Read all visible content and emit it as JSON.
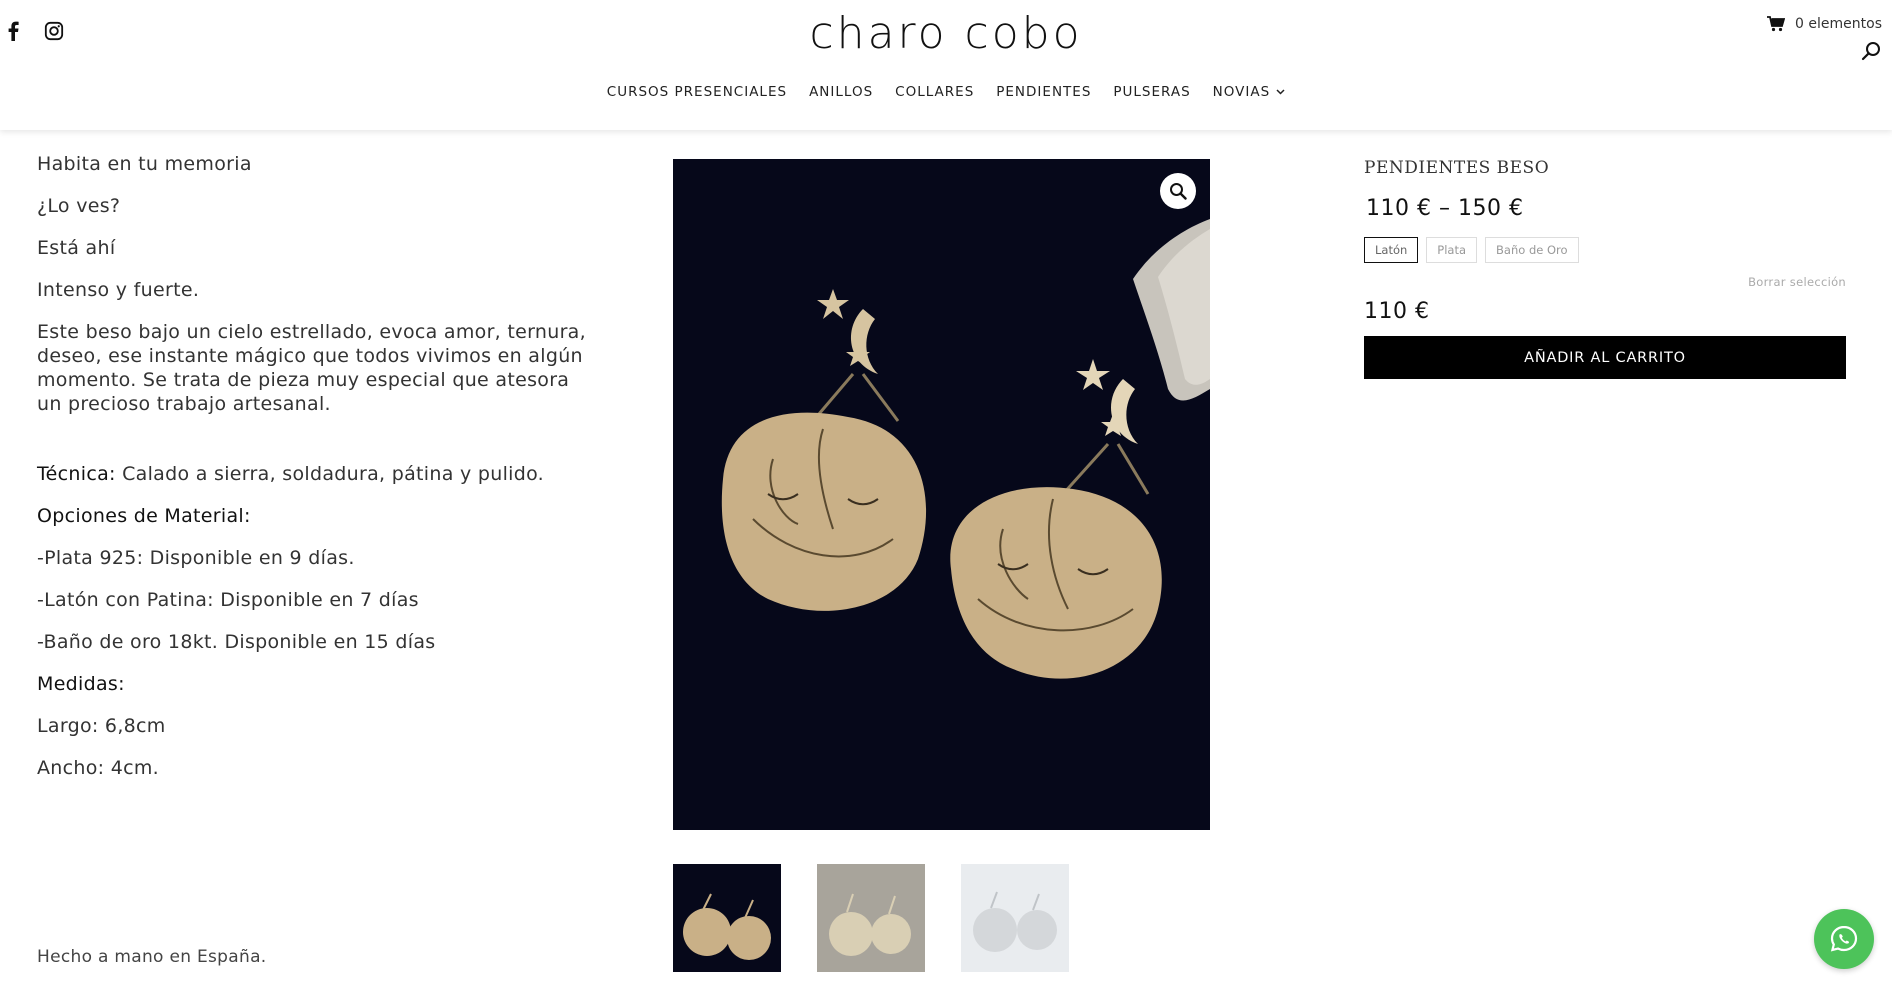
{
  "header": {
    "logo": "charo cobo",
    "cart_text": "0 elementos",
    "social": {
      "facebook_icon": "facebook-icon",
      "instagram_icon": "instagram-icon"
    },
    "nav": [
      {
        "label": "CURSOS PRESENCIALES"
      },
      {
        "label": "ANILLOS"
      },
      {
        "label": "COLLARES"
      },
      {
        "label": "PENDIENTES"
      },
      {
        "label": "PULSERAS"
      },
      {
        "label": "NOVIAS",
        "has_dropdown": true
      }
    ]
  },
  "description": {
    "lines": [
      "Habita en tu memoria",
      "¿Lo ves?",
      "Está ahí",
      "Intenso y fuerte."
    ],
    "paragraph": "Este beso bajo un cielo estrellado, evoca amor, ternura, deseo, ese instante mágico que todos vivimos en algún momento. Se trata de pieza muy especial que atesora un precioso trabajo artesanal.",
    "technique_label": "Técnica:",
    "technique_value": " Calado a sierra, soldadura, pátina y pulido.",
    "materials_label": "Opciones de Material:",
    "materials": [
      "-Plata 925: Disponible en 9 días.",
      "-Latón con Patina: Disponible en 7 días",
      "-Baño de oro 18kt. Disponible en 15 días"
    ],
    "measures_label": "Medidas:",
    "measures": [
      "Largo: 6,8cm",
      "Ancho: 4cm."
    ],
    "footer_note": "Hecho a mano en España."
  },
  "product": {
    "title": "PENDIENTES BESO",
    "price_range": "110 € – 150 €",
    "variants": [
      {
        "label": "Latón",
        "selected": true
      },
      {
        "label": "Plata",
        "selected": false
      },
      {
        "label": "Baño de Oro",
        "selected": false
      }
    ],
    "clear_selection": "Borrar selección",
    "current_price": "110 €",
    "add_to_cart": "AÑADIR AL CARRITO"
  },
  "colors": {
    "accent": "#000000",
    "image_bg": "#06081a",
    "brass": "#c9b087",
    "whatsapp": "#4dc35a"
  }
}
